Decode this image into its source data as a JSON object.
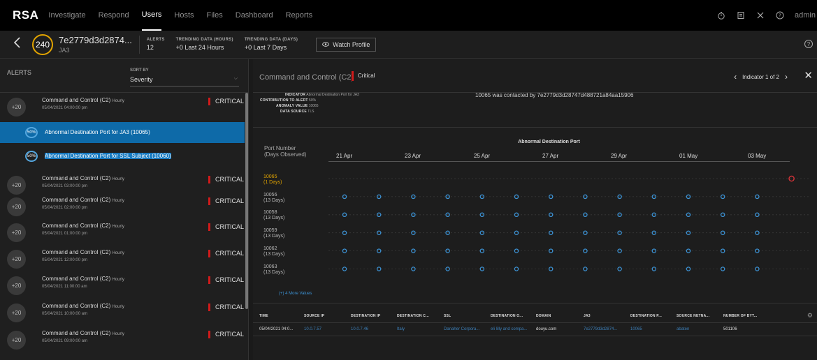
{
  "nav": {
    "brand": "RSA",
    "links": [
      "Investigate",
      "Respond",
      "Users",
      "Hosts",
      "Files",
      "Dashboard",
      "Reports"
    ],
    "active": "Users",
    "user": "admin"
  },
  "entity": {
    "score": "240",
    "name": "7e2779d3d2874...",
    "type": "JA3",
    "alerts_label": "ALERTS",
    "alerts_value": "12",
    "trend_hours_label": "TRENDING DATA (HOURS)",
    "trend_hours_value": "+0 Last 24 Hours",
    "trend_days_label": "TRENDING DATA (DAYS)",
    "trend_days_value": "+0 Last 7 Days",
    "watch_label": "Watch Profile"
  },
  "alerts_panel": {
    "title": "ALERTS",
    "sort_label": "SORT BY",
    "sort_value": "Severity",
    "alerts": [
      {
        "score": "+20",
        "title": "Command and Control (C2)",
        "freq": "Hourly",
        "date": "05/04/2021 04:00:00 pm",
        "severity": "CRITICAL"
      },
      {
        "score": "+20",
        "title": "Command and Control (C2)",
        "freq": "Hourly",
        "date": "05/04/2021 03:00:00 pm",
        "severity": "CRITICAL"
      },
      {
        "score": "+20",
        "title": "Command and Control (C2)",
        "freq": "Hourly",
        "date": "05/04/2021 02:00:00 pm",
        "severity": "CRITICAL"
      },
      {
        "score": "+20",
        "title": "Command and Control (C2)",
        "freq": "Hourly",
        "date": "05/04/2021 01:00:00 pm",
        "severity": "CRITICAL"
      },
      {
        "score": "+20",
        "title": "Command and Control (C2)",
        "freq": "Hourly",
        "date": "05/04/2021 12:00:00 pm",
        "severity": "CRITICAL"
      },
      {
        "score": "+20",
        "title": "Command and Control (C2)",
        "freq": "Hourly",
        "date": "05/04/2021 11:00:00 am",
        "severity": "CRITICAL"
      },
      {
        "score": "+20",
        "title": "Command and Control (C2)",
        "freq": "Hourly",
        "date": "05/04/2021 10:00:00 am",
        "severity": "CRITICAL"
      },
      {
        "score": "+20",
        "title": "Command and Control (C2)",
        "freq": "Hourly",
        "date": "05/04/2021 09:00:00 am",
        "severity": "CRITICAL"
      }
    ],
    "indicators": [
      {
        "pct": "50%",
        "name": "Abnormal Destination Port for JA3 (10065)"
      },
      {
        "pct": "50%",
        "name": "Abnormal Destination Port for SSL Subject (10060)"
      }
    ]
  },
  "detail": {
    "title": "Command and Control (C2)",
    "severity": "Critical",
    "pager": "Indicator 1 of 2",
    "indicator_label": "INDICATOR",
    "indicator_value": "Abnormal Destination Port for JA3",
    "contribution_label": "CONTRIBUTION TO ALERT",
    "contribution_value": "50%",
    "anomaly_label": "ANOMALY VALUE",
    "anomaly_value": "10065",
    "source_label": "DATA SOURCE",
    "source_value": "TLS",
    "contacted": "10065 was contacted by 7e2779d3d28747d488721a84aa15906"
  },
  "chart_data": {
    "type": "scatter",
    "title": "Abnormal Destination Port",
    "row_header": "Port Number",
    "row_header_sub": "(Days Observed)",
    "dates": [
      "21 Apr",
      "23 Apr",
      "25 Apr",
      "27 Apr",
      "29 Apr",
      "01 May",
      "03 May"
    ],
    "anomaly_color": "#e0343a",
    "normal_color": "#3c92d4",
    "rows": [
      {
        "port": "10065",
        "days": "(1 Days)",
        "anomaly": true,
        "observed_days": [
          13
        ]
      },
      {
        "port": "10056",
        "days": "(13 Days)",
        "anomaly": false,
        "observed_days": [
          0,
          1,
          2,
          3,
          4,
          5,
          6,
          7,
          8,
          9,
          10,
          11,
          12
        ]
      },
      {
        "port": "10058",
        "days": "(13 Days)",
        "anomaly": false,
        "observed_days": [
          0,
          1,
          2,
          3,
          4,
          5,
          6,
          7,
          8,
          9,
          10,
          11,
          12
        ]
      },
      {
        "port": "10059",
        "days": "(13 Days)",
        "anomaly": false,
        "observed_days": [
          0,
          1,
          2,
          3,
          4,
          5,
          6,
          7,
          8,
          9,
          10,
          11,
          12
        ]
      },
      {
        "port": "10062",
        "days": "(13 Days)",
        "anomaly": false,
        "observed_days": [
          0,
          1,
          2,
          3,
          4,
          5,
          6,
          7,
          8,
          9,
          10,
          11,
          12
        ]
      },
      {
        "port": "10063",
        "days": "(13 Days)",
        "anomaly": false,
        "observed_days": [
          0,
          1,
          2,
          3,
          4,
          5,
          6,
          7,
          8,
          9,
          10,
          11,
          12
        ]
      }
    ],
    "more_values": "(+) 4 More Values"
  },
  "table": {
    "columns": [
      "TIME",
      "SOURCE IP",
      "DESTINATION IP",
      "DESTINATION C...",
      "SSL",
      "DESTINATION O...",
      "DOMAIN",
      "JA3",
      "DESTINATION P...",
      "SOURCE NETNA...",
      "NUMBER OF BYT..."
    ],
    "rows": [
      [
        "05/04/2021 04:0...",
        "10.0.7.57",
        "10.0.7.46",
        "Italy",
        "Danaher Corpora...",
        "eli lilly and compa...",
        "douyu.com",
        "7e2779d3d2874...",
        "10065",
        "abaten",
        "501106"
      ]
    ]
  }
}
